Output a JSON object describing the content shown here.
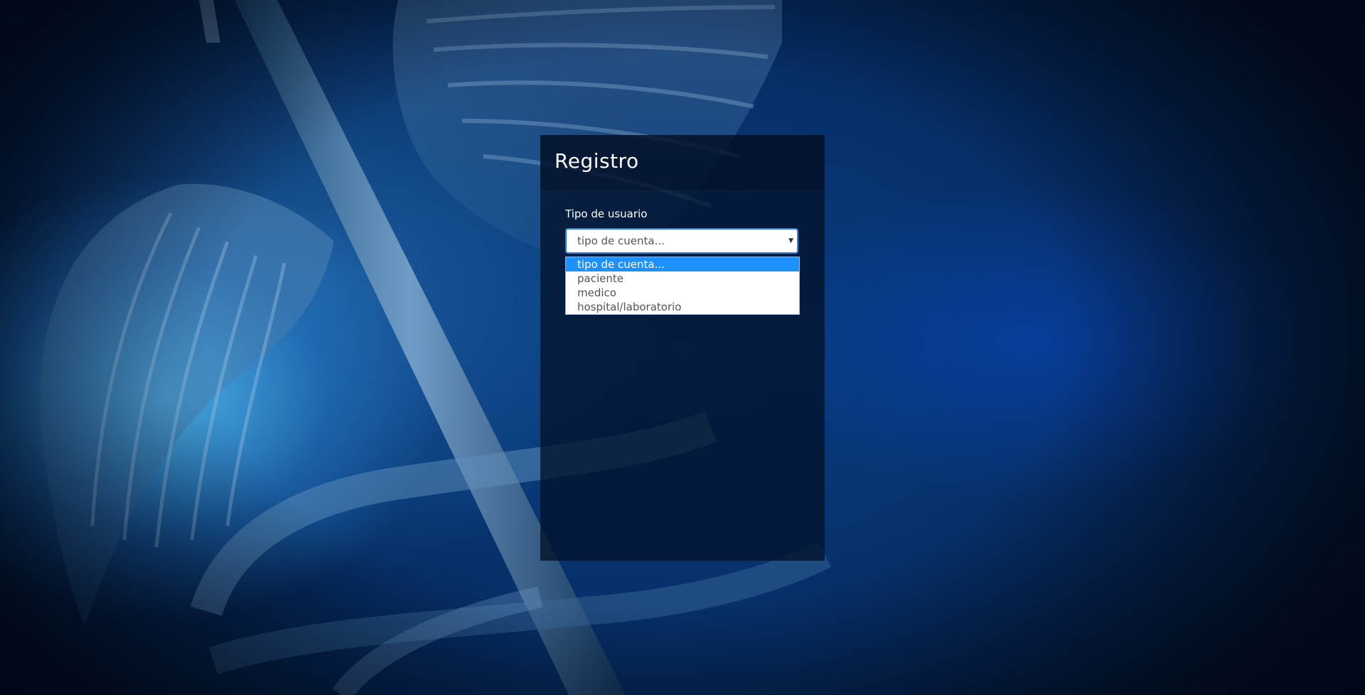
{
  "form": {
    "title": "Registro",
    "user_type_label": "Tipo de usuario",
    "select": {
      "value": "tipo de cuenta...",
      "options": [
        {
          "label": "tipo de cuenta...",
          "selected": true
        },
        {
          "label": "paciente",
          "selected": false
        },
        {
          "label": "medico",
          "selected": false
        },
        {
          "label": "hospital/laboratorio",
          "selected": false
        }
      ]
    }
  },
  "icons": {
    "select_arrow": "chevron-down-icon"
  },
  "colors": {
    "panel_bg": "#03122a",
    "highlight": "#1e90ff",
    "select_border": "#2b82d6",
    "title_text": "#ffffff"
  }
}
